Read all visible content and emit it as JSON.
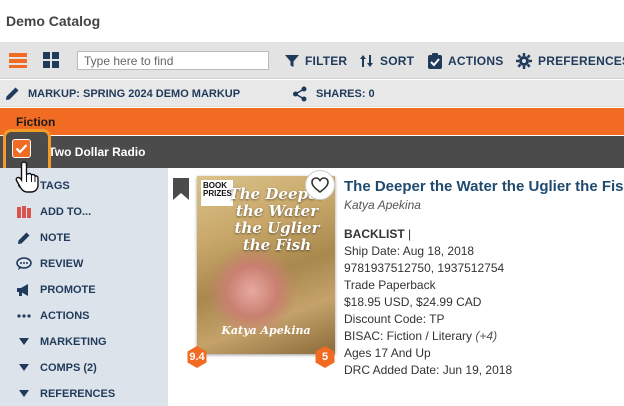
{
  "app": {
    "title": "Demo Catalog"
  },
  "toolbar": {
    "search_placeholder": "Type here to find",
    "filter_label": "FILTER",
    "sort_label": "SORT",
    "actions_label": "ACTIONS",
    "preferences_label": "PREFERENCES"
  },
  "markup": {
    "label": "MARKUP: SPRING 2024 DEMO MARKUP",
    "shares_label": "SHARES: 0"
  },
  "section": {
    "label": "Fiction"
  },
  "publisher": {
    "label": "1. Two Dollar Radio"
  },
  "sidebar": {
    "items": [
      {
        "label": "TAGS",
        "icon": "tag-icon"
      },
      {
        "label": "ADD TO...",
        "icon": "books-icon"
      },
      {
        "label": "NOTE",
        "icon": "pencil-icon"
      },
      {
        "label": "REVIEW",
        "icon": "speech-bubble-icon"
      },
      {
        "label": "PROMOTE",
        "icon": "megaphone-icon"
      },
      {
        "label": "ACTIONS",
        "icon": "ellipsis-icon"
      },
      {
        "label": "MARKETING",
        "icon": "caret-down-icon"
      },
      {
        "label": "COMPS (2)",
        "icon": "caret-down-icon"
      },
      {
        "label": "REFERENCES",
        "icon": "caret-down-icon"
      }
    ]
  },
  "book": {
    "title": "The Deeper the Water the Uglier the Fish",
    "author": "Katya Apekina",
    "cover_title": "The Deeper the Water the Uglier the Fish",
    "cover_author": "Katya Apekina",
    "cover_badge": "BOOK PRIZES",
    "score_left": "9.4",
    "score_right": "5",
    "status": "BACKLIST",
    "status_sep": "|",
    "ship_date": "Ship Date: Aug 18, 2018",
    "isbns": "9781937512750, 1937512754",
    "format": "Trade Paperback",
    "price": "$18.95 USD, $24.99 CAD",
    "discount": "Discount Code: TP",
    "bisac": "BISAC: Fiction / Literary",
    "bisac_more": "(+4)",
    "ages": "Ages 17 And Up",
    "drc": "DRC Added Date: Jun 19, 2018"
  },
  "colors": {
    "accent_orange": "#f26b22",
    "navy_text": "#1f3a5a",
    "highlight_ring": "#f29b2a"
  }
}
